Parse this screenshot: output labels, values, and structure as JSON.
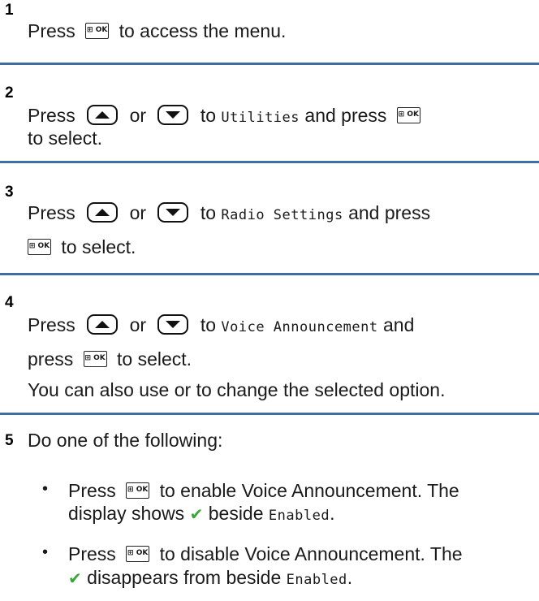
{
  "ok_key_label": "⊞ OK",
  "steps": [
    {
      "number": "1",
      "line1": {
        "press": "Press",
        "after_ok": "to access the menu."
      }
    },
    {
      "number": "2",
      "line1": {
        "press": "Press",
        "or": "or",
        "to": "to",
        "target": "Utilities",
        "and_press": "and press"
      },
      "line2": "to select."
    },
    {
      "number": "3",
      "line1": {
        "press": "Press",
        "or": "or",
        "to": "to",
        "target": "Radio Settings",
        "and_press": "and press"
      },
      "line2": {
        "after_ok": "to select."
      }
    },
    {
      "number": "4",
      "line1": {
        "press": "Press",
        "or": "or",
        "to": "to",
        "target": "Voice Announcement",
        "and": "and"
      },
      "line2": {
        "press": "press",
        "after_ok": "to select."
      },
      "line3": "You can also use or to change the selected option."
    },
    {
      "number": "5",
      "intro": "Do one of the following:",
      "bullets": [
        {
          "press": "Press",
          "after_ok": "to enable Voice Announcement. The",
          "line2_pre": "display shows",
          "line2_mid": "beside",
          "line2_target": "Enabled",
          "line2_post": "."
        },
        {
          "press": "Press",
          "after_ok": "to disable Voice Announcement. The",
          "line2_mid": "disappears from beside",
          "line2_target": "Enabled",
          "line2_post": "."
        }
      ]
    }
  ],
  "colors": {
    "separator": "#3d6fa5",
    "check": "#3aa638",
    "text": "#1a1a1a"
  },
  "icons": {
    "ok": "menu-ok-key-icon",
    "up": "up-arrow-key-icon",
    "down": "down-arrow-key-icon",
    "check": "checkmark-icon"
  }
}
